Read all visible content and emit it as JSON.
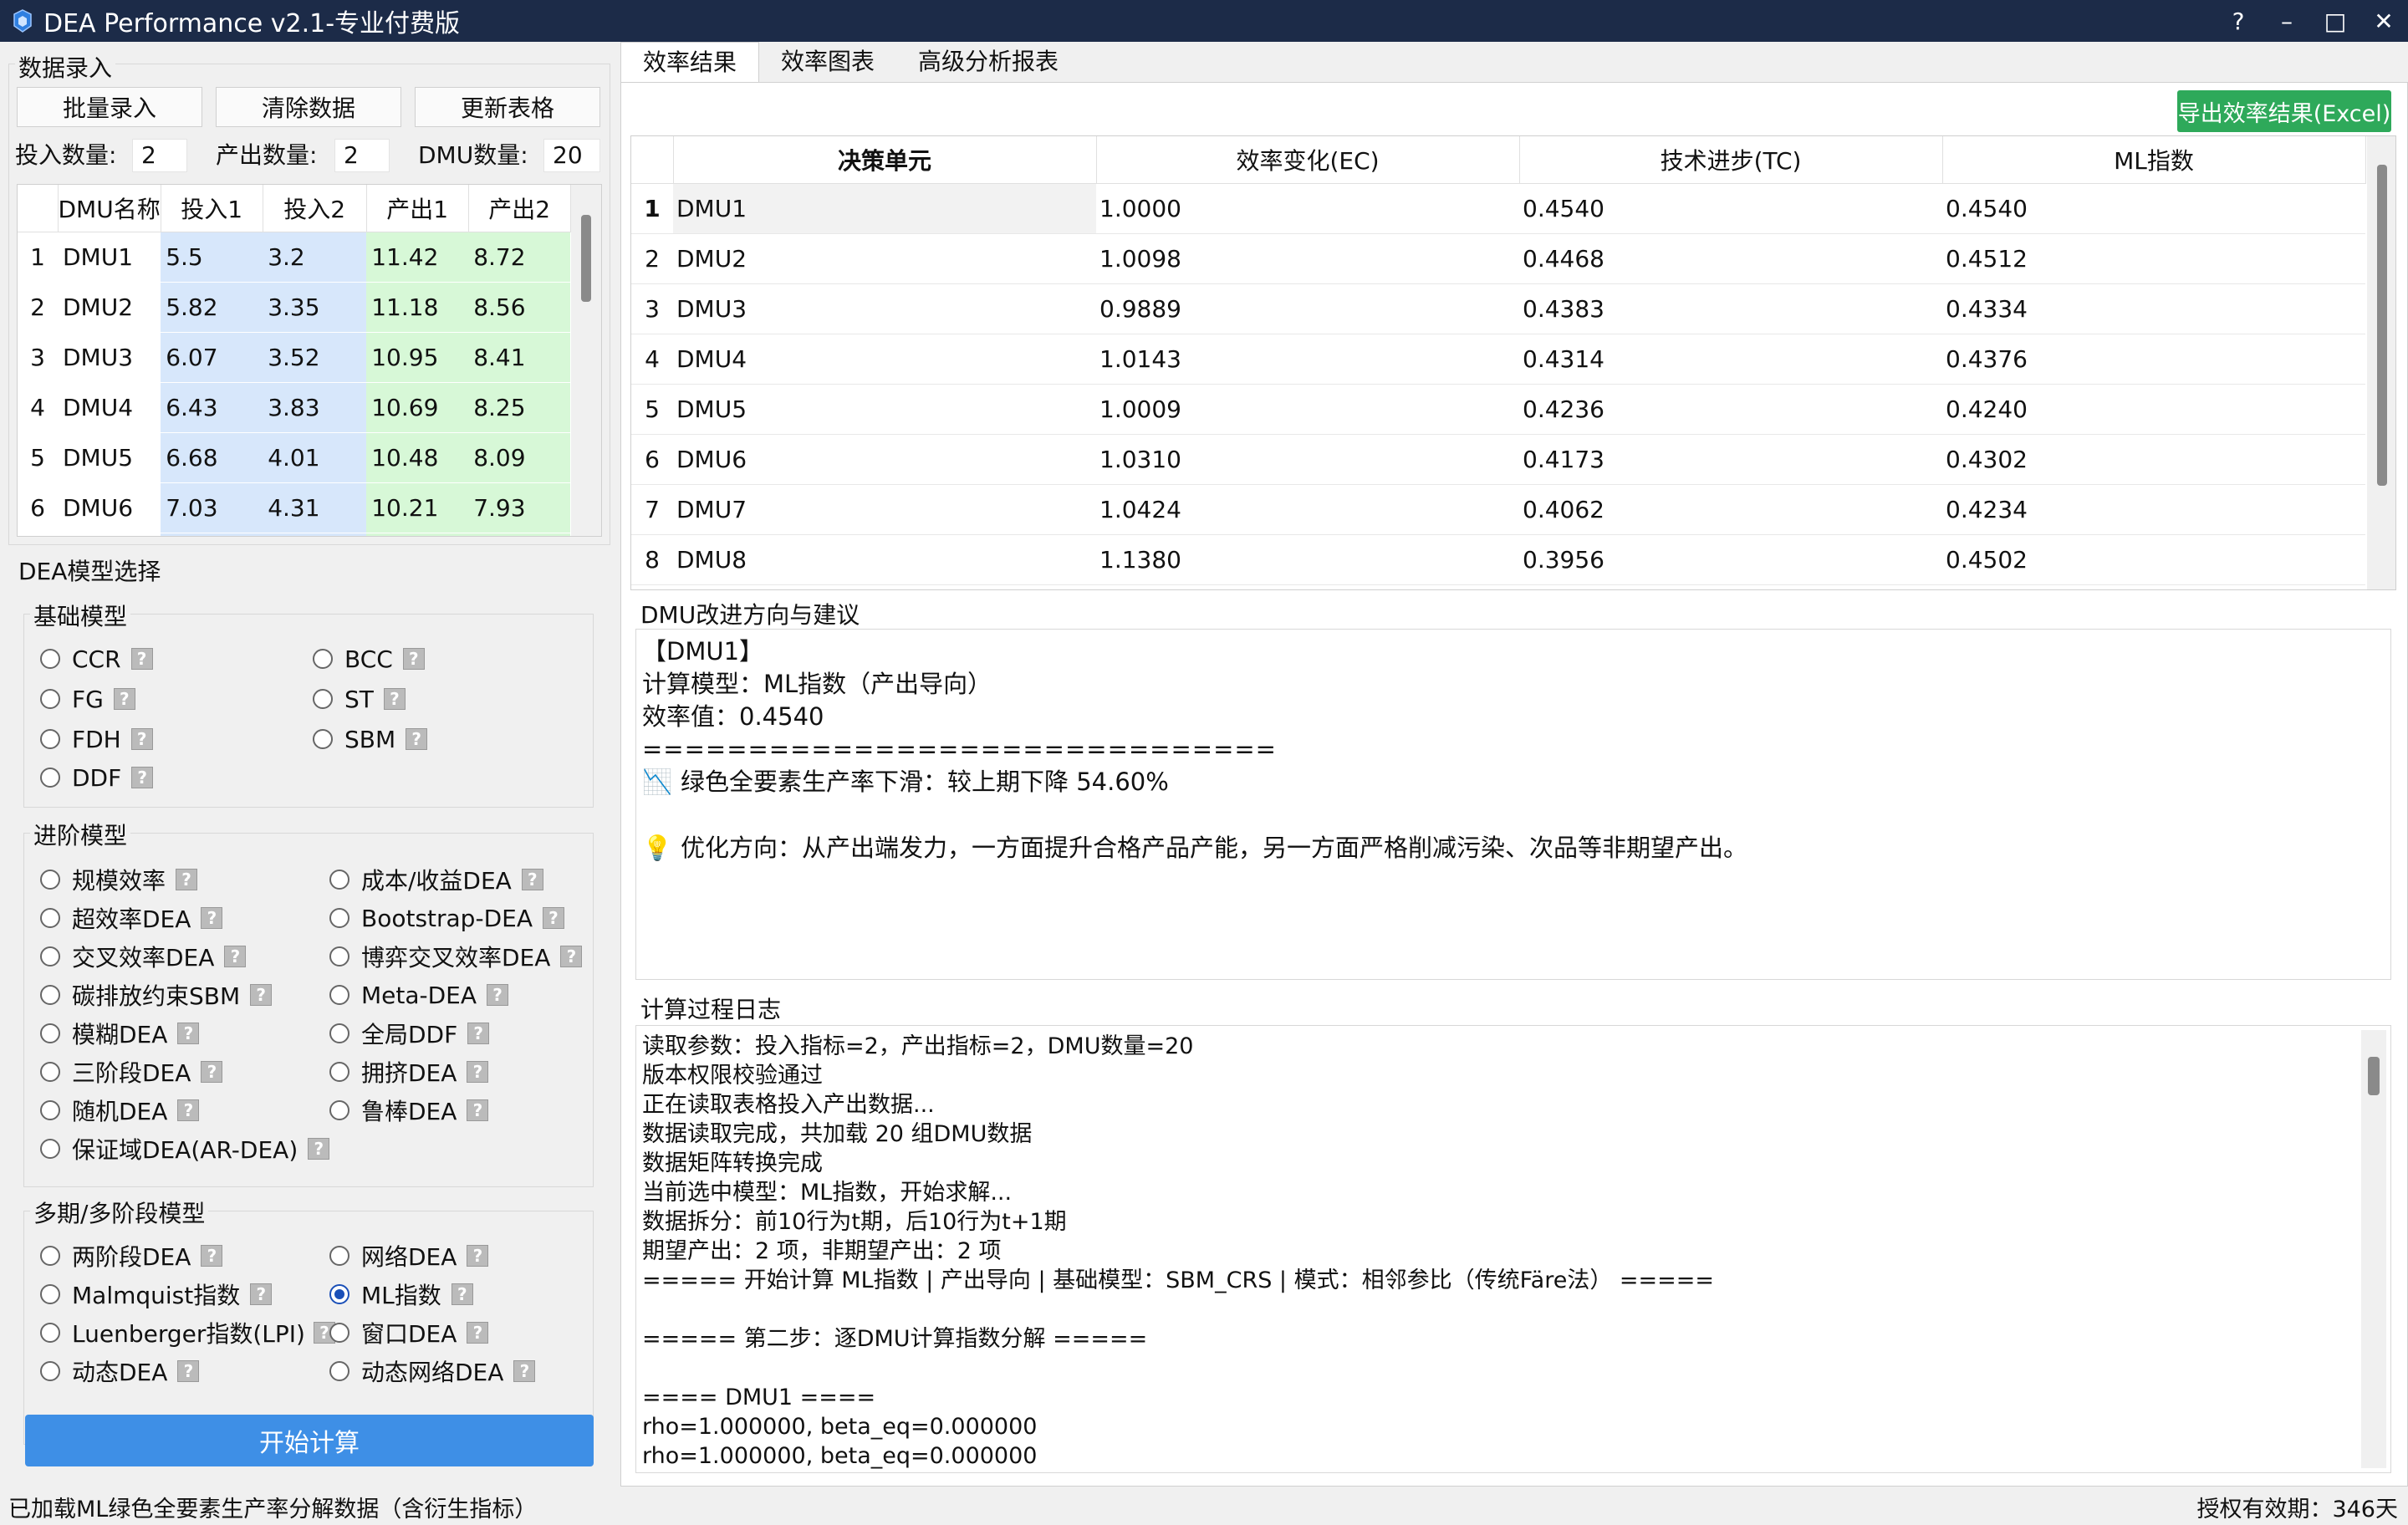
{
  "window": {
    "title": "DEA Performance v2.1-专业付费版",
    "controls": [
      "?",
      "–",
      "□",
      "✕"
    ]
  },
  "data_entry": {
    "group_title": "数据录入",
    "buttons": [
      "批量录入",
      "清除数据",
      "更新表格"
    ],
    "input_count_label": "投入数量:",
    "input_count": "2",
    "output_count_label": "产出数量:",
    "output_count": "2",
    "dmu_count_label": "DMU数量:",
    "dmu_count": "20",
    "table": {
      "headers": [
        "DMU名称",
        "投入1",
        "投入2",
        "产出1",
        "产出2"
      ],
      "rows": [
        {
          "n": "1",
          "name": "DMU1",
          "in1": "5.5",
          "in2": "3.2",
          "out1": "11.42",
          "out2": "8.72"
        },
        {
          "n": "2",
          "name": "DMU2",
          "in1": "5.82",
          "in2": "3.35",
          "out1": "11.18",
          "out2": "8.56"
        },
        {
          "n": "3",
          "name": "DMU3",
          "in1": "6.07",
          "in2": "3.52",
          "out1": "10.95",
          "out2": "8.41"
        },
        {
          "n": "4",
          "name": "DMU4",
          "in1": "6.43",
          "in2": "3.83",
          "out1": "10.69",
          "out2": "8.25"
        },
        {
          "n": "5",
          "name": "DMU5",
          "in1": "6.68",
          "in2": "4.01",
          "out1": "10.48",
          "out2": "8.09"
        },
        {
          "n": "6",
          "name": "DMU6",
          "in1": "7.03",
          "in2": "4.31",
          "out1": "10.21",
          "out2": "7.93"
        }
      ]
    }
  },
  "model_select": {
    "group_title": "DEA模型选择",
    "basic": {
      "title": "基础模型",
      "options": [
        "CCR",
        "BCC",
        "FG",
        "ST",
        "FDH",
        "SBM",
        "DDF"
      ]
    },
    "advanced": {
      "title": "进阶模型",
      "options": [
        "规模效率",
        "成本/收益DEA",
        "超效率DEA",
        "Bootstrap-DEA",
        "交叉效率DEA",
        "博弈交叉效率DEA",
        "碳排放约束SBM",
        "Meta-DEA",
        "模糊DEA",
        "全局DDF",
        "三阶段DEA",
        "拥挤DEA",
        "随机DEA",
        "鲁棒DEA",
        "保证域DEA(AR-DEA)"
      ]
    },
    "multi": {
      "title": "多期/多阶段模型",
      "options": [
        "两阶段DEA",
        "网络DEA",
        "Malmquist指数",
        "ML指数",
        "Luenberger指数(LPI)",
        "窗口DEA",
        "动态DEA",
        "动态网络DEA"
      ],
      "selected": "ML指数"
    },
    "help_glyph": "?",
    "start_button": "开始计算"
  },
  "tabs": [
    "效率结果",
    "效率图表",
    "高级分析报表"
  ],
  "active_tab": "效率结果",
  "export_button": "导出效率结果(Excel)",
  "results": {
    "headers": [
      "决策单元",
      "效率变化(EC)",
      "技术进步(TC)",
      "ML指数"
    ],
    "rows": [
      {
        "n": "1",
        "dmu": "DMU1",
        "ec": "1.0000",
        "tc": "0.4540",
        "ml": "0.4540"
      },
      {
        "n": "2",
        "dmu": "DMU2",
        "ec": "1.0098",
        "tc": "0.4468",
        "ml": "0.4512"
      },
      {
        "n": "3",
        "dmu": "DMU3",
        "ec": "0.9889",
        "tc": "0.4383",
        "ml": "0.4334"
      },
      {
        "n": "4",
        "dmu": "DMU4",
        "ec": "1.0143",
        "tc": "0.4314",
        "ml": "0.4376"
      },
      {
        "n": "5",
        "dmu": "DMU5",
        "ec": "1.0009",
        "tc": "0.4236",
        "ml": "0.4240"
      },
      {
        "n": "6",
        "dmu": "DMU6",
        "ec": "1.0310",
        "tc": "0.4173",
        "ml": "0.4302"
      },
      {
        "n": "7",
        "dmu": "DMU7",
        "ec": "1.0424",
        "tc": "0.4062",
        "ml": "0.4234"
      },
      {
        "n": "8",
        "dmu": "DMU8",
        "ec": "1.1380",
        "tc": "0.3956",
        "ml": "0.4502"
      }
    ]
  },
  "advice": {
    "title": "DMU改进方向与建议",
    "lines": [
      "【DMU1】",
      "计算模型：ML指数（产出导向）",
      "效率值：0.4540",
      "=============================="
    ],
    "decline_icon": "📉",
    "decline_text": "绿色全要素生产率下滑：较上期下降 54.60%",
    "tip_icon": "💡",
    "tip_text": "优化方向：从产出端发力，一方面提升合格产品产能，另一方面严格削减污染、次品等非期望产出。"
  },
  "log": {
    "title": "计算过程日志",
    "lines": [
      "读取参数：投入指标=2，产出指标=2，DMU数量=20",
      "版本权限校验通过",
      "正在读取表格投入产出数据...",
      "数据读取完成，共加载 20 组DMU数据",
      "数据矩阵转换完成",
      "当前选中模型：ML指数，开始求解...",
      "数据拆分：前10行为t期，后10行为t+1期",
      "期望产出：2 项，非期望产出：2 项",
      "===== 开始计算 ML指数 | 产出导向 | 基础模型：SBM_CRS | 模式：相邻参比（传统Färe法） =====",
      "",
      "===== 第二步：逐DMU计算指数分解 =====",
      "",
      "==== DMU1 ====",
      "rho=1.000000, beta_eq=0.000000",
      "rho=1.000000, beta_eq=0.000000"
    ]
  },
  "status": {
    "left": "已加载ML绿色全要素生产率分解数据（含衍生指标）",
    "right": "授权有效期：346天"
  },
  "colors": {
    "titlebar": "#1c2b48",
    "input_cells": "#d7e7fb",
    "output_cells": "#d7f8d7",
    "start_button": "#3e8fe6",
    "export_button": "#2ea95a"
  }
}
